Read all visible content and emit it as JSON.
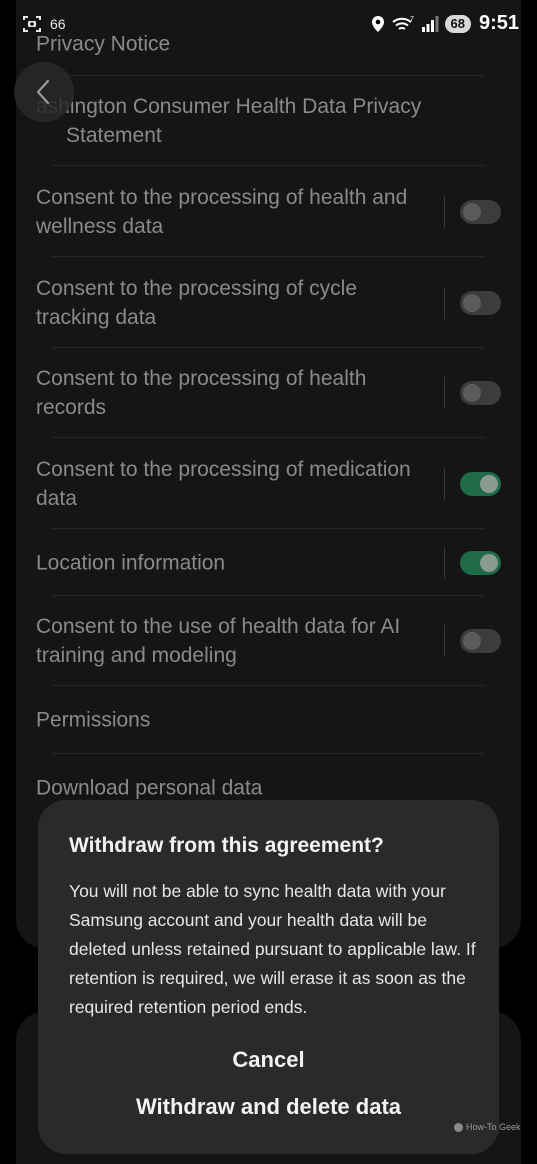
{
  "status_bar": {
    "notification_count": "66",
    "battery": "68",
    "time": "9:51",
    "icons": [
      "screenshot-icon",
      "location-icon",
      "wifi-icon",
      "signal-icon"
    ]
  },
  "settings": {
    "items": [
      {
        "label": "Privacy Notice"
      },
      {
        "label": "ashington Consumer Health Data Privacy Statement"
      },
      {
        "label": "Consent to the processing of health and wellness data",
        "toggle": false
      },
      {
        "label": "Consent to the processing of cycle tracking data",
        "toggle": false
      },
      {
        "label": "Consent to the processing of health records",
        "toggle": false
      },
      {
        "label": "Consent to the processing of medication data",
        "toggle": true
      },
      {
        "label": "Location information",
        "toggle": true
      },
      {
        "label": "Consent to the use of health data for AI training and modeling",
        "toggle": false
      },
      {
        "label": "Permissions"
      },
      {
        "label": "Download personal data"
      }
    ]
  },
  "dialog": {
    "title": "Withdraw from this agreement?",
    "body": "You will not be able to sync health data with your Samsung account and your health data will be deleted unless retained pursuant to applicable law. If retention is required, we will erase it as soon as the required retention period ends.",
    "cancel_label": "Cancel",
    "withdraw_label": "Withdraw and delete data"
  },
  "watermark": "How-To Geek",
  "colors": {
    "toggle_on": "#1f6b47",
    "dialog_bg": "#2a2a2a",
    "card_bg": "#151515"
  }
}
